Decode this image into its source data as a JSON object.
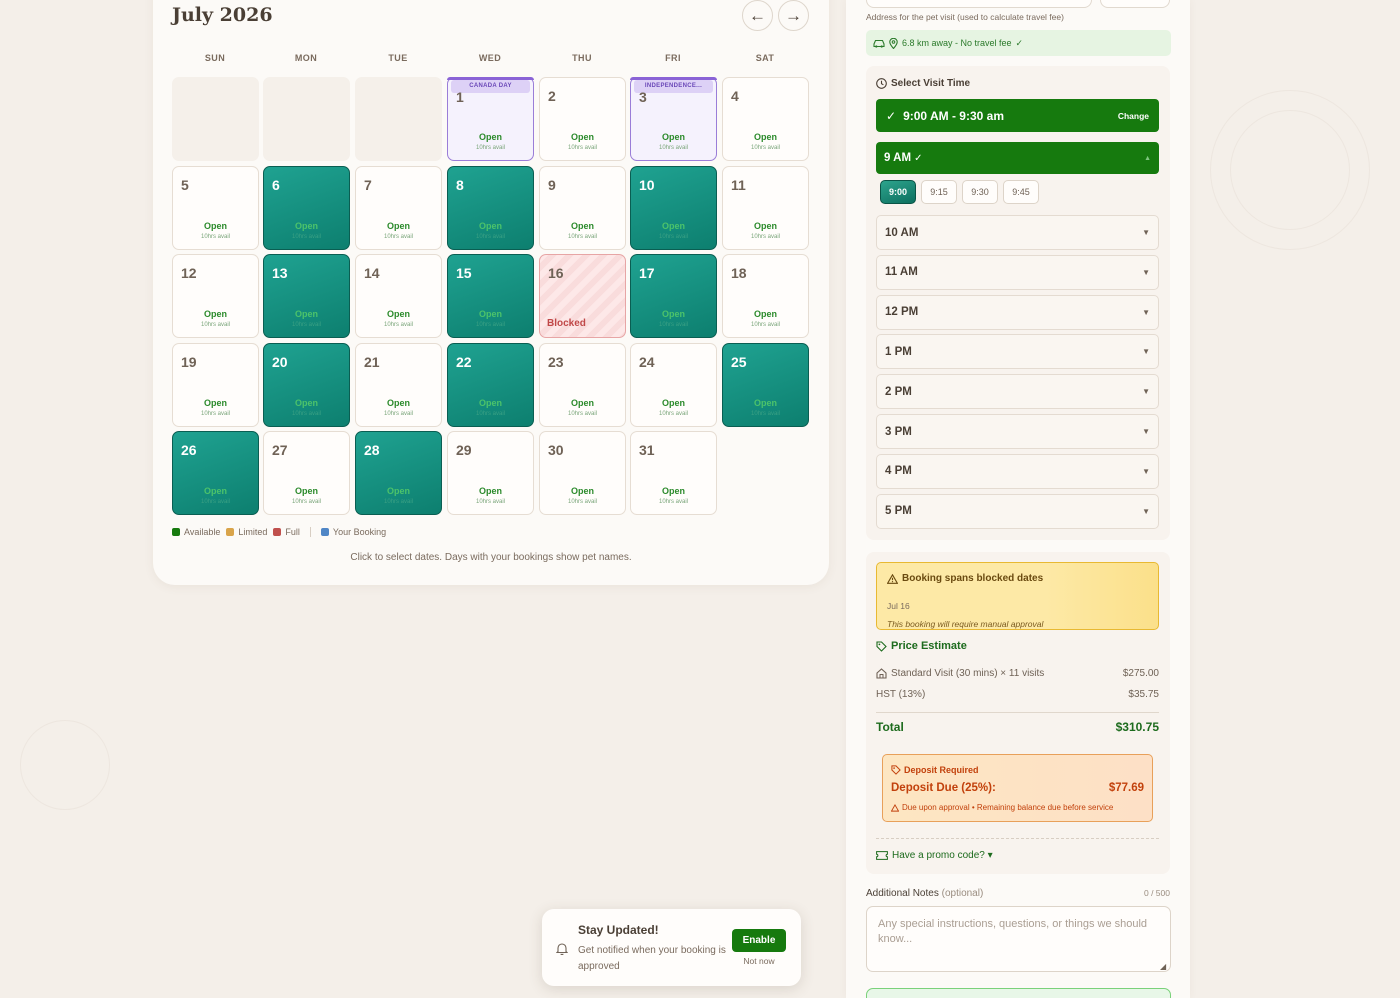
{
  "calendar": {
    "title": "July 2026",
    "prev_icon": "arrow-left-icon",
    "next_icon": "arrow-right-icon",
    "weekdays": [
      "SUN",
      "MON",
      "TUE",
      "WED",
      "THU",
      "FRI",
      "SAT"
    ],
    "open_label": "Open",
    "avail_label": "10hrs avail",
    "blocked_label": "Blocked",
    "days": [
      {
        "n": "",
        "type": "empty"
      },
      {
        "n": "",
        "type": "empty"
      },
      {
        "n": "",
        "type": "empty"
      },
      {
        "n": "1",
        "type": "holiday",
        "tag": "CANADA DAY"
      },
      {
        "n": "2",
        "type": "open"
      },
      {
        "n": "3",
        "type": "holiday",
        "tag": "INDEPENDENCE..."
      },
      {
        "n": "4",
        "type": "open"
      },
      {
        "n": "5",
        "type": "open"
      },
      {
        "n": "6",
        "type": "selected"
      },
      {
        "n": "7",
        "type": "open"
      },
      {
        "n": "8",
        "type": "selected"
      },
      {
        "n": "9",
        "type": "open"
      },
      {
        "n": "10",
        "type": "selected"
      },
      {
        "n": "11",
        "type": "open"
      },
      {
        "n": "12",
        "type": "open"
      },
      {
        "n": "13",
        "type": "selected"
      },
      {
        "n": "14",
        "type": "open"
      },
      {
        "n": "15",
        "type": "selected"
      },
      {
        "n": "16",
        "type": "blocked"
      },
      {
        "n": "17",
        "type": "selected"
      },
      {
        "n": "18",
        "type": "open"
      },
      {
        "n": "19",
        "type": "open"
      },
      {
        "n": "20",
        "type": "selected"
      },
      {
        "n": "21",
        "type": "open"
      },
      {
        "n": "22",
        "type": "selected"
      },
      {
        "n": "23",
        "type": "open"
      },
      {
        "n": "24",
        "type": "open"
      },
      {
        "n": "25",
        "type": "selected"
      },
      {
        "n": "26",
        "type": "selected"
      },
      {
        "n": "27",
        "type": "open"
      },
      {
        "n": "28",
        "type": "selected"
      },
      {
        "n": "29",
        "type": "open"
      },
      {
        "n": "30",
        "type": "open"
      },
      {
        "n": "31",
        "type": "open"
      }
    ],
    "legend": [
      {
        "label": "Available",
        "color": "#167a0e"
      },
      {
        "label": "Limited",
        "color": "#d9a44a"
      },
      {
        "label": "Full",
        "color": "#c0504d"
      },
      {
        "label": "Your Booking",
        "color": "#4f86c6"
      }
    ],
    "hint": "Click to select dates. Days with your bookings show pet names."
  },
  "location": {
    "address_hint": "Address for the pet visit (used to calculate travel fee)",
    "travel_text": "6.8 km away - No travel fee"
  },
  "visit_time": {
    "heading": "Select Visit Time",
    "selected_range": "9:00 AM - 9:30 am",
    "change_label": "Change",
    "open_hour": "9 AM",
    "minutes": [
      "9:00",
      "9:15",
      "9:30",
      "9:45"
    ],
    "selected_minute": "9:00",
    "hours": [
      "10 AM",
      "11 AM",
      "12 PM",
      "1 PM",
      "2 PM",
      "3 PM",
      "4 PM",
      "5 PM"
    ]
  },
  "warning": {
    "title": "Booking spans blocked dates",
    "dates": "Jul 16",
    "note": "This booking will require manual approval"
  },
  "price": {
    "heading": "Price Estimate",
    "service_line": "Standard Visit (30 mins) × 11 visits",
    "service_amount": "$275.00",
    "tax_line": "HST (13%)",
    "tax_amount": "$35.75",
    "total_label": "Total",
    "total_amount": "$310.75",
    "deposit_required": "Deposit Required",
    "deposit_label": "Deposit Due (25%):",
    "deposit_amount": "$77.69",
    "deposit_note": "Due upon approval • Remaining balance due before service",
    "promo_label": "Have a promo code? ▾"
  },
  "notes": {
    "label": "Additional Notes",
    "optional": "(optional)",
    "counter": "0 / 500",
    "placeholder": "Any special instructions, questions, or things we should know..."
  },
  "toast": {
    "title": "Stay Updated!",
    "body": "Get notified when your booking is approved",
    "enable_label": "Enable",
    "dismiss_label": "Not now"
  }
}
